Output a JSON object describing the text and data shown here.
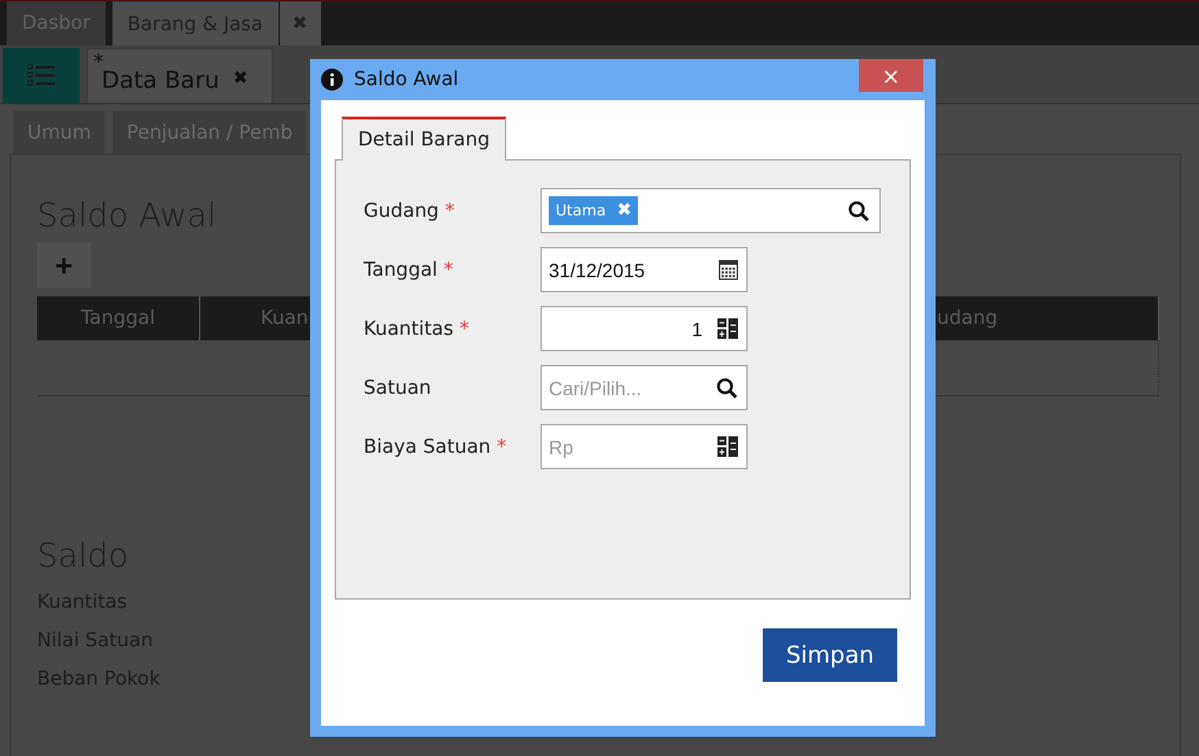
{
  "top_tabs": [
    {
      "label": "Dasbor",
      "selected": false
    },
    {
      "label": "Barang & Jasa",
      "selected": true
    }
  ],
  "top_tab_close": "✖",
  "doc_tab": {
    "modified_mark": "*",
    "label": "Data Baru",
    "close": "✖"
  },
  "sub_tabs": [
    {
      "label": "Umum",
      "selected": false
    },
    {
      "label": "Penjualan / Pemb",
      "selected": false
    }
  ],
  "saldo_awal": {
    "title": "Saldo Awal",
    "add_button": "+",
    "columns": [
      "Tanggal",
      "Kuan",
      "udang"
    ]
  },
  "saldo": {
    "title": "Saldo",
    "items": [
      "Kuantitas",
      "Nilai Satuan",
      "Beban Pokok"
    ]
  },
  "dialog": {
    "title": "Saldo Awal",
    "close": "×",
    "tabs": [
      {
        "label": "Detail Barang",
        "selected": true
      }
    ],
    "fields": [
      {
        "kind": "tags",
        "label": "Gudang",
        "required": true,
        "tags": [
          {
            "label": "Utama",
            "remove": "✖"
          }
        ]
      },
      {
        "kind": "date",
        "label": "Tanggal",
        "required": true,
        "value": "31/12/2015"
      },
      {
        "kind": "number",
        "label": "Kuantitas",
        "required": true,
        "value": "1"
      },
      {
        "kind": "search",
        "label": "Satuan",
        "required": false,
        "placeholder": "Cari/Pilih..."
      },
      {
        "kind": "number",
        "label": "Biaya Satuan",
        "required": true,
        "placeholder": "Rp"
      }
    ],
    "save_button": "Simpan"
  }
}
